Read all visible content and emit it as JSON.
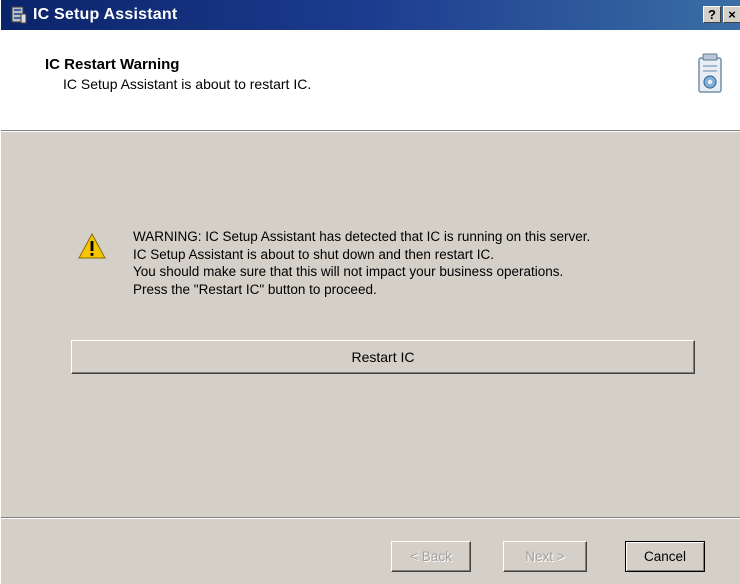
{
  "window": {
    "title": "IC Setup Assistant",
    "help_label": "?",
    "close_label": "×"
  },
  "header": {
    "title": "IC Restart Warning",
    "subtitle": "IC Setup Assistant is about to restart IC.",
    "icon": "wizard-setup-icon"
  },
  "warning": {
    "icon": "warning-triangle-icon",
    "lines": [
      "WARNING:  IC Setup Assistant has detected that IC is running on this server.",
      "IC Setup Assistant is about to shut down and then restart IC.",
      "You should make sure that this will not impact your business operations.",
      "Press the \"Restart IC\" button to proceed."
    ]
  },
  "restart_button": {
    "label": "Restart IC"
  },
  "footer": {
    "back_label": "< Back",
    "next_label": "Next >",
    "cancel_label": "Cancel"
  },
  "colors": {
    "titlebar_start": "#0a246a",
    "titlebar_end": "#3a6ea5",
    "dialog_bg": "#d4d0c8",
    "header_bg": "#ffffff"
  }
}
